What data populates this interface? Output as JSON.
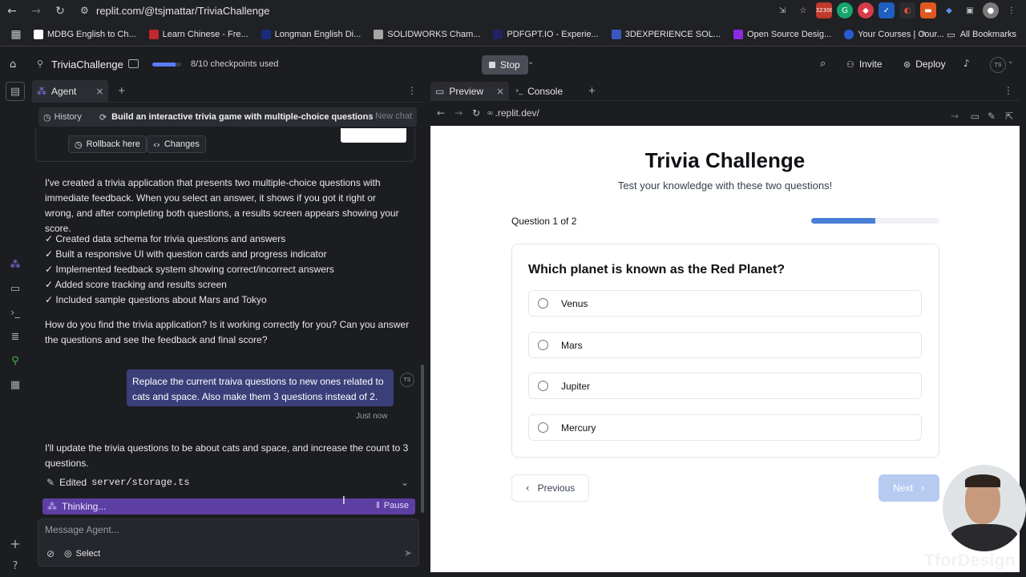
{
  "browser": {
    "url": "replit.com/@tsjmattar/TriviaChallenge",
    "badge_count": "3230t",
    "bookmarks": [
      {
        "label": "MDBG English to Ch...",
        "color": "#ffffff"
      },
      {
        "label": "Learn Chinese - Fre...",
        "color": "#c1272d"
      },
      {
        "label": "Longman English Di...",
        "color": "#1b2c7a"
      },
      {
        "label": "SOLIDWORKS Cham...",
        "color": "#a6a6a6"
      },
      {
        "label": "PDFGPT.IO - Experie...",
        "color": "#222266"
      },
      {
        "label": "3DEXPERIENCE SOL...",
        "color": "#3a57c4"
      },
      {
        "label": "Open Source Desig...",
        "color": "#8a2be2"
      },
      {
        "label": "Your Courses | Cour...",
        "color": "#2a5bd7"
      }
    ],
    "all_bookmarks": "All Bookmarks"
  },
  "app": {
    "project_name": "TriviaChallenge",
    "checkpoints": "8/10 checkpoints used",
    "checkpoints_progress": 0.8,
    "stop_label": "Stop",
    "invite_label": "Invite",
    "deploy_label": "Deploy",
    "avatar_initials": "TS"
  },
  "agent": {
    "tab_label": "Agent",
    "history_label": "History",
    "thread_title": "Build an interactive trivia game with multiple-choice questions",
    "new_chat_label": "New chat",
    "rollback_label": "Rollback here",
    "changes_label": "Changes",
    "summary": "I've created a trivia application that presents two multiple-choice questions with immediate feedback. When you select an answer, it shows if you got it right or wrong, and after completing both questions, a results screen appears showing your score.",
    "checklist": [
      "✓ Created data schema for trivia questions and answers",
      "✓ Built a responsive UI with question cards and progress indicator",
      "✓ Implemented feedback system showing correct/incorrect answers",
      "✓ Added score tracking and results screen",
      "✓ Included sample questions about Mars and Tokyo"
    ],
    "followup": "How do you find the trivia application? Is it working correctly for you? Can you answer the questions and see the feedback and final score?",
    "user_message": "Replace the current traiva questions to new ones related to cats and space. Also make them 3 questions instead of 2.",
    "user_initials": "TS",
    "timestamp": "Just now",
    "reply": "I'll update the trivia questions to be about cats and space, and increase the count to 3 questions.",
    "edited_prefix": "Edited",
    "edited_file": "server/storage.ts",
    "thinking_label": "Thinking...",
    "pause_label": "Pause",
    "composer_placeholder": "Message Agent...",
    "select_label": "Select"
  },
  "preview": {
    "tab_preview": "Preview",
    "tab_console": "Console",
    "address": ".replit.dev/",
    "title": "Trivia Challenge",
    "subtitle": "Test your knowledge with these two questions!",
    "question_counter": "Question 1 of 2",
    "progress": 0.5,
    "question": "Which planet is known as the Red Planet?",
    "options": [
      "Venus",
      "Mars",
      "Jupiter",
      "Mercury"
    ],
    "previous_label": "Previous",
    "next_label": "Next"
  },
  "watermark": "TforDesign"
}
